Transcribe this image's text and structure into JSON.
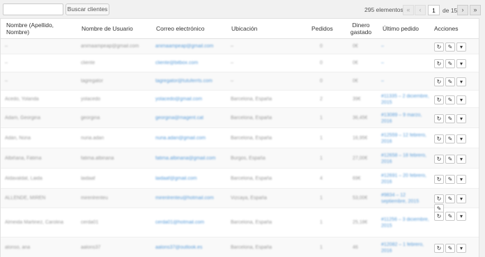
{
  "toolbar": {
    "search_value": "",
    "search_button": "Buscar clientes"
  },
  "pagination": {
    "count": "295 elementos",
    "first": "«",
    "prev": "‹",
    "current": "1",
    "of": "de 15",
    "next": "›",
    "last": "»"
  },
  "columns": [
    "Nombre (Apellido, Nombre)",
    "Nombre de Usuario",
    "Correo electrónico",
    "Ubicación",
    "Pedidos",
    "Dinero gastado",
    "Último pedido",
    "Acciones"
  ],
  "actions": {
    "refresh": "↻",
    "edit": "✎",
    "view": "▾",
    "extra": "✎"
  },
  "rows": [
    {
      "name": "–",
      "user": "animaampeap@gmail.com",
      "email": "animaampeap@gmail.com",
      "location": "–",
      "orders": "0",
      "spent": "0€",
      "last": "–"
    },
    {
      "name": "–",
      "user": "cliente",
      "email": "cliente@bitbox.com",
      "location": "–",
      "orders": "0",
      "spent": "0€",
      "last": "–"
    },
    {
      "name": "–",
      "user": "tagregator",
      "email": "tagregator@tutuferrts.com",
      "location": "–",
      "orders": "0",
      "spent": "0€",
      "last": "–"
    },
    {
      "name": "Acedo, Yolanda",
      "user": "yolacedo",
      "email": "yolacedo@gmail.com",
      "location": "Barcelona, España",
      "orders": "2",
      "spent": "39€",
      "last": "#11335 – 2 diciembre, 2015"
    },
    {
      "name": "Adam, Georgina",
      "user": "georgina",
      "email": "georgina@magent.cat",
      "location": "Barcelona, España",
      "orders": "1",
      "spent": "36,45€",
      "last": "#13089 – 9 marzo, 2016"
    },
    {
      "name": "Adán, Núria",
      "user": "nuria.adan",
      "email": "nuria.adan@gmail.com",
      "location": "Barcelona, España",
      "orders": "1",
      "spent": "16,95€",
      "last": "#12559 – 12 febrero, 2016"
    },
    {
      "name": "Albiñana, Fátima",
      "user": "fatima.albinana",
      "email": "fatima.albinana@gmail.com",
      "location": "Burgos, España",
      "orders": "1",
      "spent": "27,00€",
      "last": "#12658 – 18 febrero, 2016"
    },
    {
      "name": "Aldavaldat, Laida",
      "user": "laidaaf",
      "email": "laidaaf@gmail.com",
      "location": "Barcelona, España",
      "orders": "4",
      "spent": "69€",
      "last": "#12691 – 20 febrero, 2016"
    },
    {
      "name": "ALLENDE, MIREN",
      "user": "mirenlrenteu",
      "email": "mirenlrenteu@hotmail.com",
      "location": "Vizcaya, España",
      "orders": "1",
      "spent": "53,00€",
      "last": "#9834 – 12 septiembre, 2015"
    },
    {
      "name": "Almeida Martinez, Carolina",
      "user": "cerda01",
      "email": "cerda01@hotmail.com",
      "location": "Barcelona, España",
      "orders": "1",
      "spent": "25,18€",
      "last": "#11256 – 3 diciembre, 2015"
    },
    {
      "name": "alonso, ana",
      "user": "aalons37",
      "email": "aalons37@outlook.es",
      "location": "Barcelona, España",
      "orders": "1",
      "spent": "46",
      "last": "#12082 – 1 febrero, 2016"
    }
  ]
}
